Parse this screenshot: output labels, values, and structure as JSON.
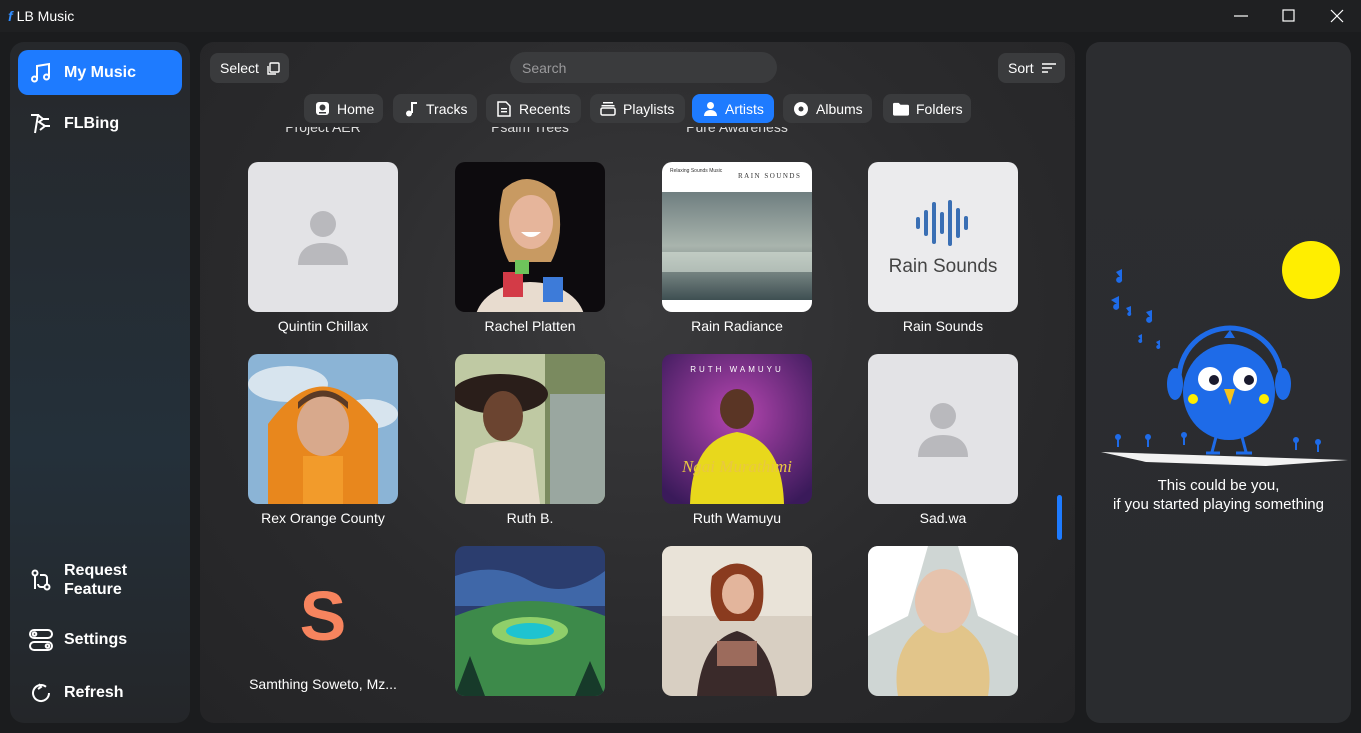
{
  "window": {
    "logo_letter": "f",
    "title": "LB Music"
  },
  "sidebar": {
    "items": [
      {
        "label": "My Music",
        "icon": "music-note-icon",
        "active": true
      },
      {
        "label": "FLBing",
        "icon": "flbing-icon",
        "active": false
      }
    ],
    "bottom_items": [
      {
        "label_line1": "Request",
        "label_line2": "Feature",
        "icon": "request-feature-icon"
      },
      {
        "label": "Settings",
        "icon": "settings-toggle-icon"
      },
      {
        "label": "Refresh",
        "icon": "refresh-icon"
      }
    ]
  },
  "toolbar": {
    "select_label": "Select",
    "search_placeholder": "Search",
    "sort_label": "Sort"
  },
  "tabs": [
    {
      "label": "Home",
      "icon": "home-icon",
      "active": false
    },
    {
      "label": "Tracks",
      "icon": "music-note-icon",
      "active": false
    },
    {
      "label": "Recents",
      "icon": "document-icon",
      "active": false
    },
    {
      "label": "Playlists",
      "icon": "playlist-icon",
      "active": false
    },
    {
      "label": "Artists",
      "icon": "person-icon",
      "active": true
    },
    {
      "label": "Albums",
      "icon": "disc-icon",
      "active": false
    },
    {
      "label": "Folders",
      "icon": "folder-icon",
      "active": false
    }
  ],
  "partial_row": [
    "Project AER",
    "Psalm Trees",
    "Pure Awareness"
  ],
  "artists": [
    {
      "name": "Quintin Chillax",
      "art": "placeholder"
    },
    {
      "name": "Rachel Platten",
      "art": "photo"
    },
    {
      "name": "Rain Radiance",
      "art": "cover",
      "cover_text_left": "Relaxing Sounds Music",
      "cover_text_right": "RAIN SOUNDS"
    },
    {
      "name": "Rain Sounds",
      "art": "logo",
      "logo_text": "Rain Sounds"
    },
    {
      "name": "Rex Orange County",
      "art": "photo"
    },
    {
      "name": "Ruth B.",
      "art": "photo"
    },
    {
      "name": "Ruth Wamuyu",
      "art": "cover",
      "cover_text_top": "RUTH WAMUYU",
      "cover_script": "Ngai Murathimi"
    },
    {
      "name": "Sad.wa",
      "art": "placeholder"
    },
    {
      "name": "Samthing Soweto, Mz...",
      "art": "letter",
      "letter": "S"
    },
    {
      "name": "",
      "art": "photo"
    },
    {
      "name": "",
      "art": "photo"
    },
    {
      "name": "",
      "art": "photo"
    }
  ],
  "now_playing_empty": {
    "line1": "This could be you,",
    "line2": "if you started playing something"
  },
  "colors": {
    "accent": "#1e7bff",
    "letter_avatar": "#f7845e",
    "sun": "#ffee00",
    "bird": "#1e6be8"
  }
}
